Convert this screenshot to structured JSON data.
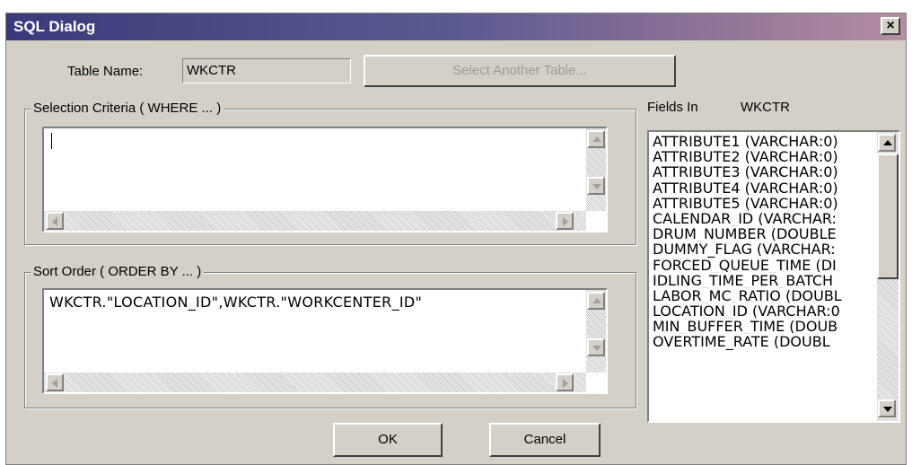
{
  "window": {
    "title": "SQL Dialog",
    "close_label": "×"
  },
  "table": {
    "label": "Table Name:",
    "value": "WKCTR",
    "select_button": "Select Another Table..."
  },
  "selection": {
    "group_title": "Selection Criteria ( WHERE ... )",
    "value": ""
  },
  "sort": {
    "group_title": "Sort Order ( ORDER BY ... )",
    "value": "WKCTR.\"LOCATION_ID\",WKCTR.\"WORKCENTER_ID\""
  },
  "fields": {
    "label": "Fields In",
    "table": "WKCTR",
    "items": [
      "ATTRIBUTE1 (VARCHAR:0)",
      "ATTRIBUTE2 (VARCHAR:0)",
      "ATTRIBUTE3 (VARCHAR:0)",
      "ATTRIBUTE4 (VARCHAR:0)",
      "ATTRIBUTE5 (VARCHAR:0)",
      "CALENDAR_ID (VARCHAR:",
      "DRUM_NUMBER (DOUBLE",
      "DUMMY_FLAG (VARCHAR:",
      "FORCED_QUEUE_TIME (DI",
      "IDLING_TIME_PER_BATCH",
      "LABOR_MC_RATIO (DOUBL",
      "LOCATION_ID (VARCHAR:0",
      "MIN_BUFFER_TIME (DOUB",
      "OVERTIME_RATE (DOUBL"
    ]
  },
  "buttons": {
    "ok": "OK",
    "cancel": "Cancel"
  },
  "colors": {
    "face": "#d4d0c8",
    "title_start": "#3a3a7a",
    "title_end": "#b58ea3"
  }
}
